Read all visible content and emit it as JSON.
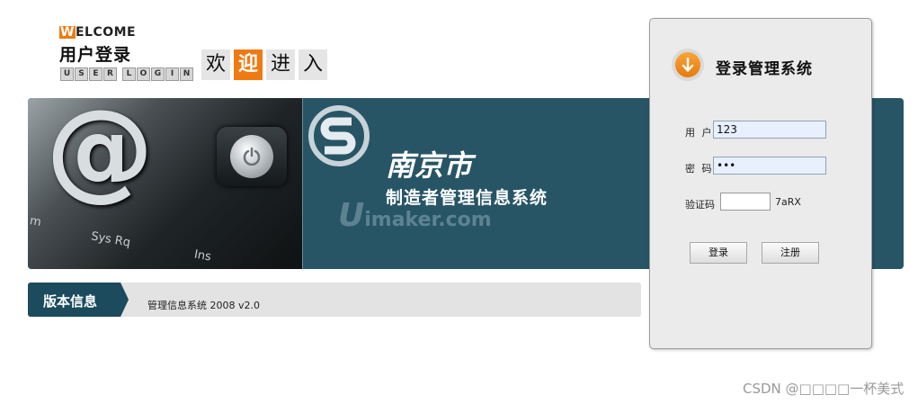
{
  "welcome": {
    "welcome_first_letter": "W",
    "welcome_rest": "ELCOME",
    "user_login_cn": "用户登录",
    "user_login_en_letters": [
      "U",
      "S",
      "E",
      "R",
      " ",
      "L",
      "O",
      "G",
      "I",
      "N"
    ],
    "enter_chars": [
      "欢",
      "迎",
      "进",
      "入"
    ]
  },
  "banner": {
    "key_label_1": "m",
    "key_label_2": "Sys Rq",
    "key_label_3": "Ins",
    "city": "南京市",
    "subtitle": "制造者管理信息系统",
    "site_u": "U",
    "site_rest": "imaker.com"
  },
  "version": {
    "tab_label": "版本信息",
    "text": "管理信息系统 2008 v2.0"
  },
  "login": {
    "title": "登录管理系统",
    "user_label": "用 户",
    "user_value": "123",
    "password_label": "密 码",
    "password_value": "•••",
    "captcha_label": "验证码",
    "captcha_value": "",
    "captcha_code": "7aRX",
    "login_button": "登录",
    "register_button": "注册"
  },
  "footer": {
    "watermark": "CSDN @□□□□一杯美式"
  },
  "colors": {
    "accent_orange": "#f07a12",
    "banner_teal": "#275566",
    "version_tab": "#1b4b5c"
  }
}
